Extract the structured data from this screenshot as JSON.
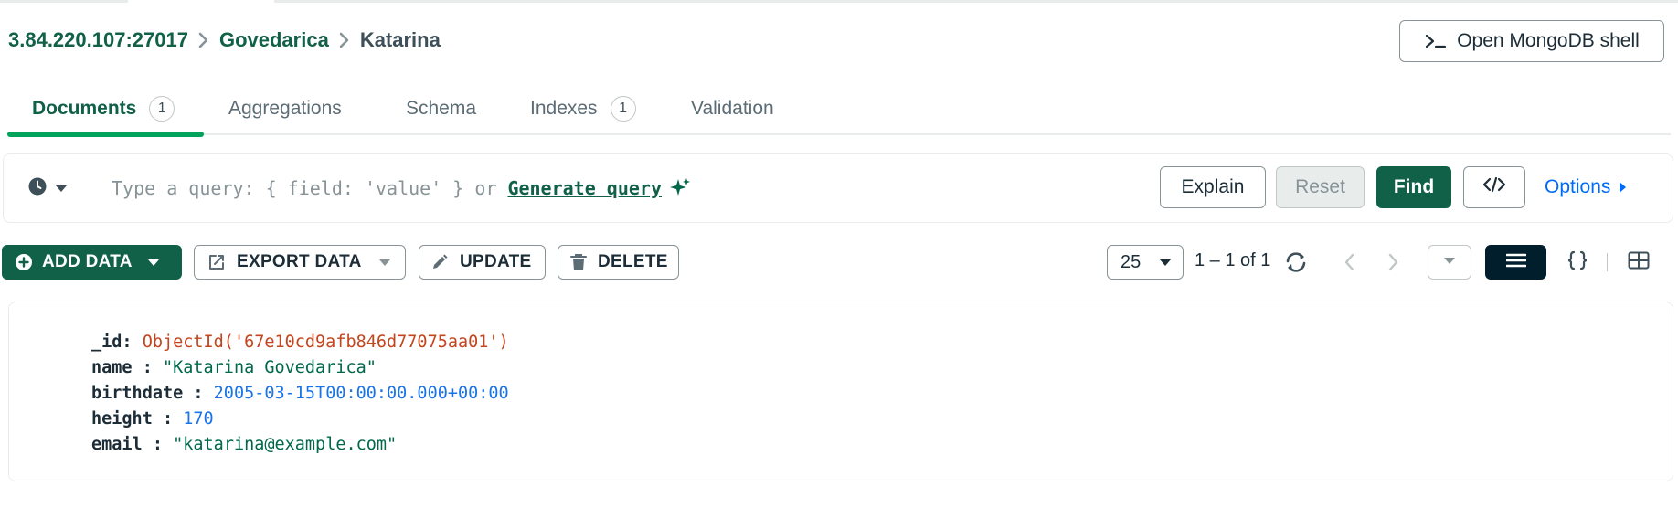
{
  "header": {
    "breadcrumb": {
      "host": "3.84.220.107:27017",
      "database": "Govedarica",
      "collection": "Katarina"
    },
    "shell_button_label": "Open MongoDB shell"
  },
  "tabs": [
    {
      "label": "Documents",
      "badge": "1",
      "active": true
    },
    {
      "label": "Aggregations"
    },
    {
      "label": "Schema"
    },
    {
      "label": "Indexes",
      "badge": "1"
    },
    {
      "label": "Validation"
    }
  ],
  "query_bar": {
    "placeholder": "Type a query: { field: 'value' } or",
    "generate_link": "Generate query",
    "explain_label": "Explain",
    "reset_label": "Reset",
    "find_label": "Find",
    "options_label": "Options"
  },
  "toolbar": {
    "add_data_label": "ADD DATA",
    "export_data_label": "EXPORT DATA",
    "update_label": "UPDATE",
    "delete_label": "DELETE",
    "page_size": "25",
    "range_text": "1 – 1 of 1",
    "active_view": "list"
  },
  "document": {
    "fields": [
      {
        "key": "_id",
        "sep": ": ",
        "value": "ObjectId('67e10cd9afb846d77075aa01')",
        "type": "objectid"
      },
      {
        "key": "name",
        "sep": " : ",
        "value": "\"Katarina Govedarica\"",
        "type": "string"
      },
      {
        "key": "birthdate",
        "sep": " : ",
        "value": "2005-03-15T00:00:00.000+00:00",
        "type": "date"
      },
      {
        "key": "height",
        "sep": " : ",
        "value": "170",
        "type": "number"
      },
      {
        "key": "email",
        "sep": " : ",
        "value": "\"katarina@example.com\"",
        "type": "string"
      }
    ]
  },
  "colors": {
    "brand_green": "#116149",
    "accent_green": "#00a35c",
    "link_blue": "#016bf8",
    "objectid_orange": "#c4451c",
    "date_blue": "#1a74e8"
  }
}
